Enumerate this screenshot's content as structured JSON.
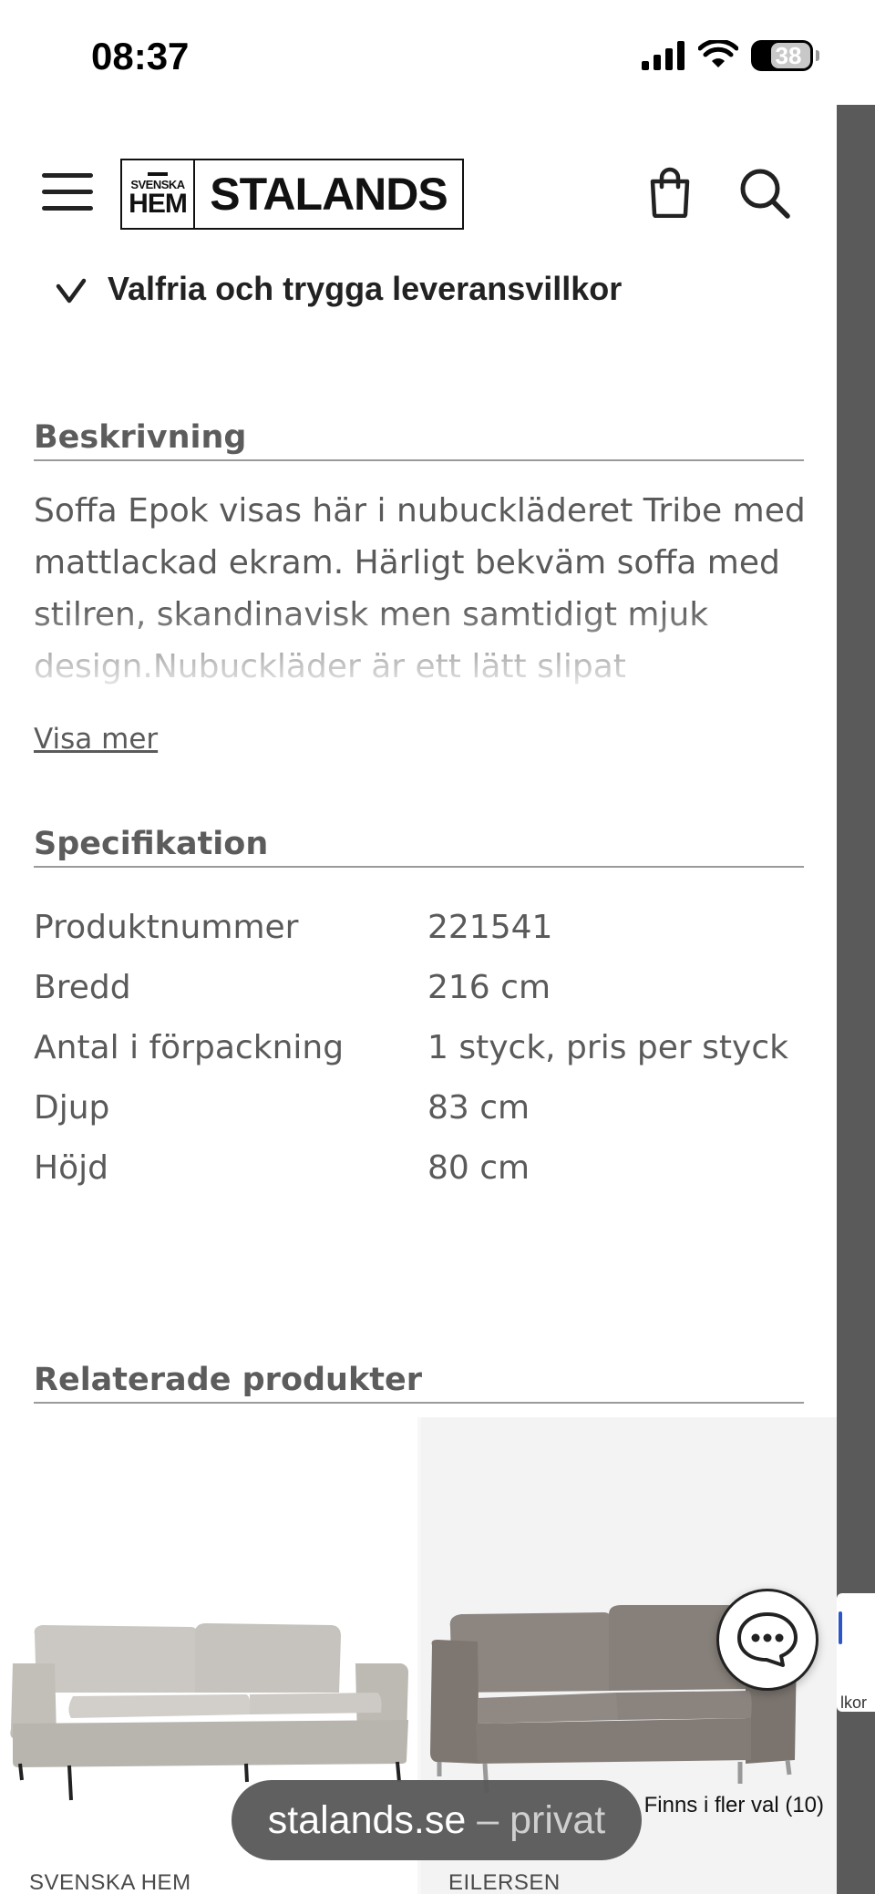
{
  "status_bar": {
    "time": "08:37",
    "battery": "38"
  },
  "header": {
    "logo": {
      "small_top": "SVENSKA",
      "small_bottom": "HEM",
      "main": "STALANDS"
    }
  },
  "usp": {
    "text": "Valfria och trygga leveransvillkor"
  },
  "description": {
    "heading": "Beskrivning",
    "text": "Soffa Epok visas här i nubuckläderet Tribe med mattlackad ekram. Härligt bekväm soffa med stilren, skandinavisk men samtidigt mjuk design.Nubuckläder är ett lätt slipat",
    "show_more": "Visa mer"
  },
  "specification": {
    "heading": "Specifikation",
    "rows": [
      {
        "key": "Produktnummer",
        "value": "221541"
      },
      {
        "key": "Bredd",
        "value": "216 cm"
      },
      {
        "key": "Antal i förpackning",
        "value": "1 styck, pris per styck"
      },
      {
        "key": "Djup",
        "value": "83 cm"
      },
      {
        "key": "Höjd",
        "value": "80 cm"
      }
    ]
  },
  "related": {
    "heading": "Relaterade produkter",
    "products": [
      {
        "brand": "SVENSKA HEM",
        "variants": ""
      },
      {
        "brand": "EILERSEN",
        "variants": "Finns i fler val (10)"
      }
    ]
  },
  "edge_tab": {
    "text": "lkor"
  },
  "url_bar": {
    "domain": "stalands.se",
    "separator": " – ",
    "mode": "privat"
  },
  "colors": {
    "heading": "#5c5c5c",
    "body_text": "#5a5a5a",
    "scrollbar": "#5a5a5a",
    "url_pill": "#5a5a5a"
  }
}
